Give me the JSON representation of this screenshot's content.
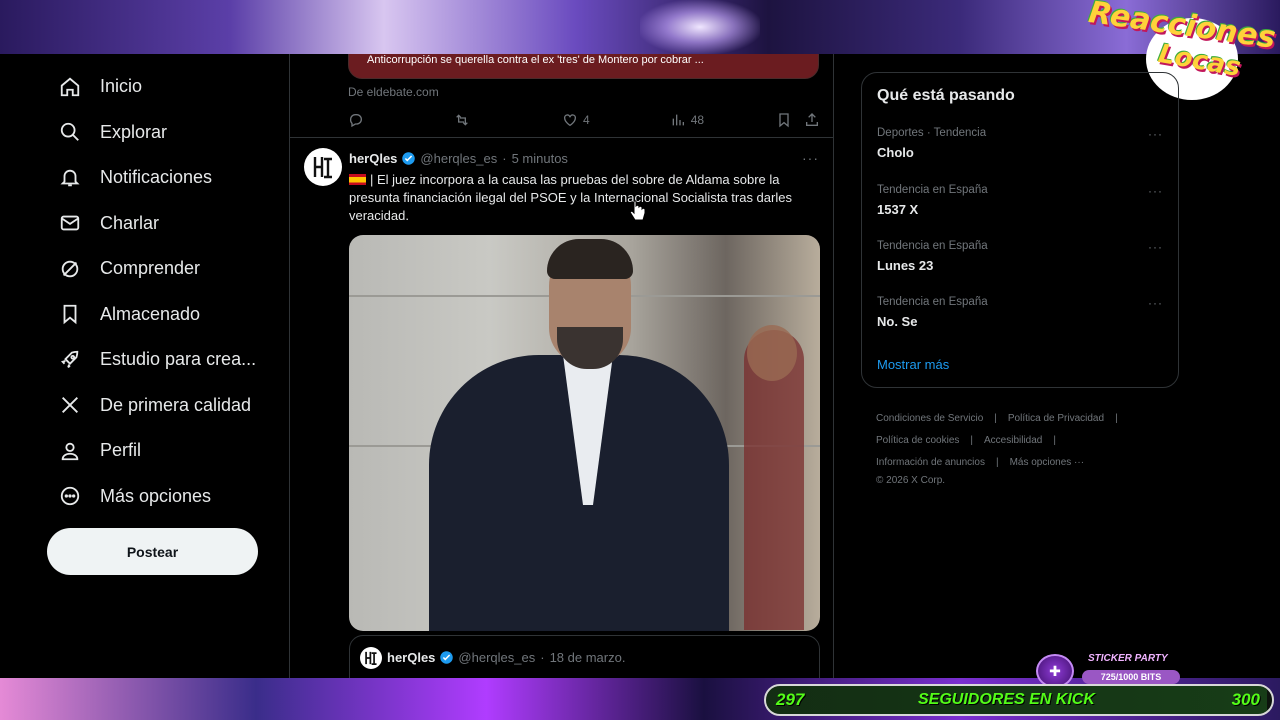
{
  "overlay": {
    "logo_line1": "Reacciones",
    "logo_line2": "Locas",
    "sticker_title": "STICKER PARTY",
    "sticker_bits": "725/1000 BITS",
    "sticker_progress": 0.725,
    "follow_start": "297",
    "follow_label": "SEGUIDORES EN KICK",
    "follow_end": "300",
    "follow_progress": 0.99,
    "accent": "#53fc18"
  },
  "nav": {
    "items": [
      {
        "label": "Inicio",
        "icon": "home-icon"
      },
      {
        "label": "Explorar",
        "icon": "search-icon"
      },
      {
        "label": "Notificaciones",
        "icon": "bell-icon"
      },
      {
        "label": "Charlar",
        "icon": "mail-icon"
      },
      {
        "label": "Comprender",
        "icon": "grok-icon"
      },
      {
        "label": "Almacenado",
        "icon": "bookmark-icon"
      },
      {
        "label": "Estudio para crea...",
        "icon": "rocket-icon"
      },
      {
        "label": "De primera calidad",
        "icon": "x-logo-icon"
      },
      {
        "label": "Perfil",
        "icon": "person-icon"
      },
      {
        "label": "Más opciones",
        "icon": "more-circle-icon"
      }
    ],
    "post_label": "Postear"
  },
  "prev_tweet": {
    "card_text": "Anticorrupción se querella contra el ex 'tres' de Montero por cobrar ...",
    "source": "De  eldebate.com",
    "replies": "",
    "retweets": "",
    "likes": "4",
    "views": "48"
  },
  "tweet": {
    "name": "herQles",
    "handle": "@herqles_es",
    "dot": "·",
    "time": "5 minutos",
    "text": "| El juez incorpora a la causa las pruebas del sobre de Aldama sobre la presunta financiación ilegal del PSOE y la Internacional Socialista tras darles veracidad.",
    "more": "···"
  },
  "quote": {
    "name": "herQles",
    "handle": "@herqles_es",
    "dot": "·",
    "time": "18 de marzo."
  },
  "trends": {
    "title": "Qué está pasando",
    "items": [
      {
        "meta": "Deportes · Tendencia",
        "name": "Cholo"
      },
      {
        "meta": "Tendencia en España",
        "name": "1537 X"
      },
      {
        "meta": "Tendencia en España",
        "name": "Lunes 23"
      },
      {
        "meta": "Tendencia en España",
        "name": "No. Se"
      }
    ],
    "more": "···",
    "show_more": "Mostrar más"
  },
  "footer": {
    "terms": "Condiciones de Servicio",
    "privacy": "Política de Privacidad",
    "cookies": "Política de cookies",
    "accessibility": "Accesibilidad",
    "ads": "Información de anuncios",
    "more": "Más opciones ···",
    "copyright": "© 2026 X Corp."
  }
}
